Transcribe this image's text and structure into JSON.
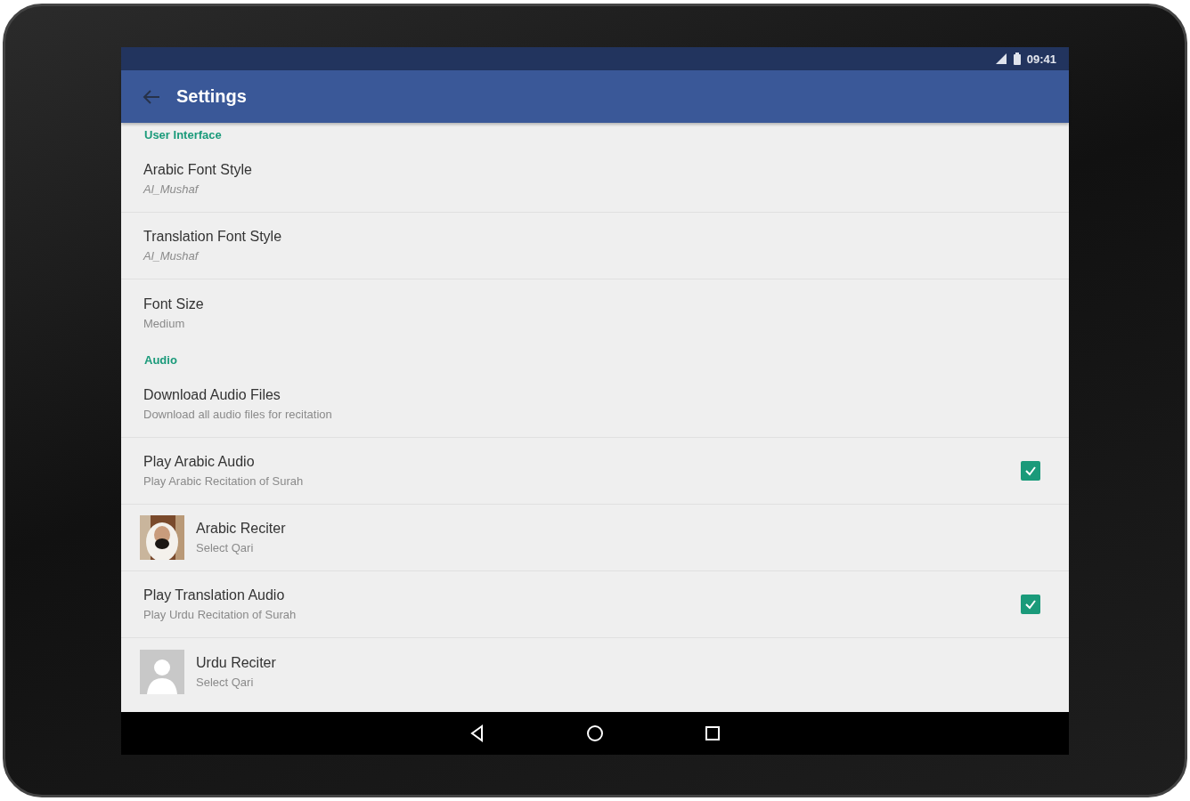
{
  "status_bar": {
    "time": "09:41"
  },
  "app_bar": {
    "title": "Settings"
  },
  "sections": [
    {
      "header": "User Interface",
      "items": [
        {
          "kind": "text",
          "title": "Arabic Font Style",
          "summary": "Al_Mushaf",
          "italic_summary": true
        },
        {
          "kind": "text",
          "title": "Translation Font Style",
          "summary": "Al_Mushaf",
          "italic_summary": true
        },
        {
          "kind": "text",
          "title": "Font Size",
          "summary": "Medium",
          "italic_summary": false
        }
      ]
    },
    {
      "header": "Audio",
      "items": [
        {
          "kind": "text",
          "title": "Download Audio Files",
          "summary": "Download all audio files for recitation",
          "italic_summary": false
        },
        {
          "kind": "checkbox",
          "title": "Play Arabic Audio",
          "summary": "Play Arabic Recitation of Surah",
          "checked": true
        },
        {
          "kind": "photo-avatar",
          "title": "Arabic Reciter",
          "summary": "Select Qari"
        },
        {
          "kind": "checkbox",
          "title": "Play Translation Audio",
          "summary": "Play Urdu Recitation of Surah",
          "checked": true
        },
        {
          "kind": "placeholder-avatar",
          "title": "Urdu Reciter",
          "summary": "Select Qari"
        }
      ]
    }
  ]
}
